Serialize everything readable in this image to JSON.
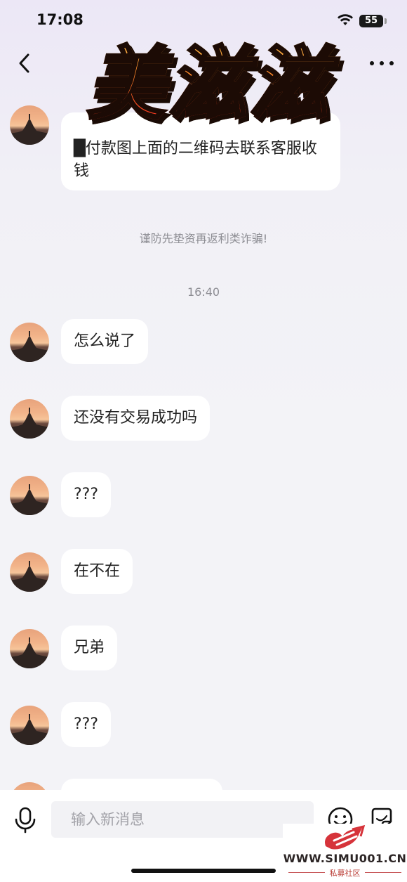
{
  "status_bar": {
    "time": "17:08",
    "battery": "55"
  },
  "header": {
    "title_sticker": "美滋滋",
    "back_icon": "chevron-left-icon",
    "more_icon": "more-horizontal-icon"
  },
  "messages_top": [
    {
      "text": "█付款图上面的二维码去联系客服收钱"
    }
  ],
  "notice": "谨防先垫资再返利类诈骗!",
  "timestamp": "16:40",
  "messages": [
    {
      "text": "怎么说了"
    },
    {
      "text": "还没有交易成功吗"
    },
    {
      "text": "???"
    },
    {
      "text": "在不在"
    },
    {
      "text": "兄弟"
    },
    {
      "text": "???"
    }
  ],
  "composer": {
    "placeholder": "输入新消息",
    "mic_icon": "microphone-icon",
    "emoji_icon": "emoji-icon",
    "sticker_icon": "sticker-icon"
  },
  "watermark": {
    "url": "WWW.SIMU001.CN",
    "subtitle": "私募社区"
  },
  "colors": {
    "background": "#f3f3f7",
    "bubble": "#ffffff",
    "text": "#222222",
    "muted": "#8d8d93"
  }
}
